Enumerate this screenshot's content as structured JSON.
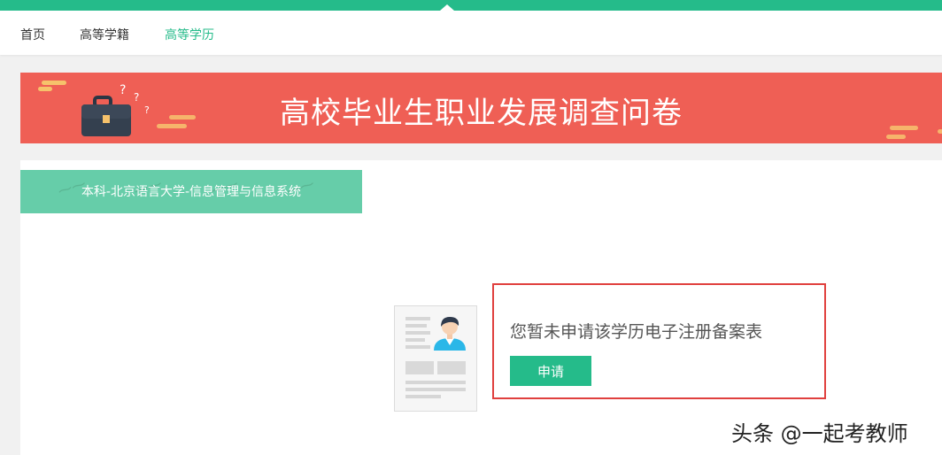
{
  "nav": {
    "items": [
      {
        "label": "首页"
      },
      {
        "label": "高等学籍"
      },
      {
        "label": "高等学历"
      }
    ],
    "active_index": 2
  },
  "banner": {
    "title": "高校毕业生职业发展调查问卷"
  },
  "record": {
    "school_label": "本科-北京语言大学-信息管理与信息系统",
    "notice_text": "您暂未申请该学历电子注册备案表",
    "apply_label": "申请"
  },
  "watermark": {
    "text": "头条 @一起考教师"
  },
  "colors": {
    "brand_green": "#25bb8a",
    "banner_red": "#ef5f55",
    "tab_green": "#66cda9",
    "highlight_red": "#e0403e"
  }
}
